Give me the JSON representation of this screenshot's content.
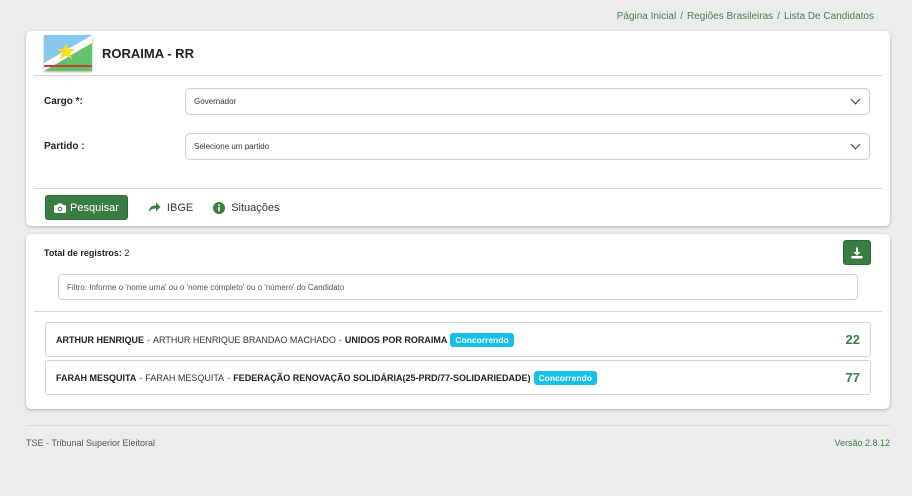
{
  "breadcrumb": {
    "items": [
      "Página Inicial",
      "Regiões Brasileiras",
      "Lista De Candidatos"
    ],
    "separator": "/"
  },
  "header": {
    "state_title": "RORAIMA - RR"
  },
  "form": {
    "cargo_label": "Cargo *:",
    "cargo_value": "Governador",
    "partido_label": "Partido :",
    "partido_value": "Selecione um partido"
  },
  "actions": {
    "search_label": "Pesquisar",
    "ibge_label": "IBGE",
    "situacoes_label": "Situações"
  },
  "results": {
    "total_label": "Total de registros:",
    "total_value": "2",
    "filter_placeholder": "Filtro: Informe o 'nome urna' ou o 'nome completo' ou o 'número' do Candidato",
    "candidates": [
      {
        "nome_urna": "ARTHUR HENRIQUE",
        "nome_completo": "ARTHUR HENRIQUE BRANDAO MACHADO",
        "partido": "UNIDOS POR RORAIMA",
        "situacao": "Concorrendo",
        "numero": "22"
      },
      {
        "nome_urna": "FARAH MESQUITA",
        "nome_completo": "FARAH MESQUITA",
        "partido": "FEDERAÇÃO RENOVAÇÃO SOLIDÁRIA(25-PRD/77-SOLIDARIEDADE)",
        "situacao": "Concorrendo",
        "numero": "77"
      }
    ],
    "dash": "-"
  },
  "footer": {
    "left": "TSE - Tribunal Superior Eleitoral",
    "right": "Versão 2.8.12"
  },
  "colors": {
    "primary_green": "#3a7d44",
    "badge_cyan": "#17c0e8",
    "background": "#ececec"
  },
  "icons": {
    "search_button": "camera-icon",
    "ibge": "share-arrow-icon",
    "situacoes": "info-circle-icon",
    "download": "download-icon",
    "select_chevron": "chevron-down-icon"
  }
}
